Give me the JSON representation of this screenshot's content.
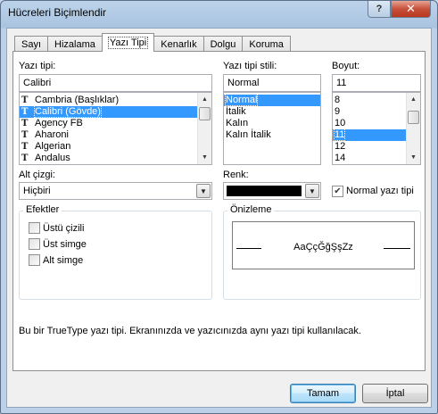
{
  "window": {
    "title": "Hücreleri Biçimlendir",
    "help_label": "?",
    "close_label": "✕"
  },
  "tabs": [
    {
      "label": "Sayı",
      "active": false
    },
    {
      "label": "Hizalama",
      "active": false
    },
    {
      "label": "Yazı Tipi",
      "active": true
    },
    {
      "label": "Kenarlık",
      "active": false
    },
    {
      "label": "Dolgu",
      "active": false
    },
    {
      "label": "Koruma",
      "active": false
    }
  ],
  "font": {
    "label": "Yazı tipi:",
    "value": "Calibri",
    "items": [
      {
        "label": "Cambria (Başlıklar)",
        "icon": "truetype-icon",
        "selected": false
      },
      {
        "label": "Calibri (Gövde)",
        "icon": "truetype-icon",
        "selected": true
      },
      {
        "label": "Agency FB",
        "icon": "truetype-icon",
        "selected": false
      },
      {
        "label": "Aharoni",
        "icon": "truetype-icon",
        "selected": false
      },
      {
        "label": "Algerian",
        "icon": "truetype-icon",
        "selected": false
      },
      {
        "label": "Andalus",
        "icon": "truetype-icon",
        "selected": false
      }
    ]
  },
  "style": {
    "label": "Yazı tipi stili:",
    "value": "Normal",
    "items": [
      {
        "label": "Normal",
        "selected": true
      },
      {
        "label": "İtalik",
        "selected": false
      },
      {
        "label": "Kalın",
        "selected": false
      },
      {
        "label": "Kalın İtalik",
        "selected": false
      }
    ]
  },
  "size": {
    "label": "Boyut:",
    "value": "11",
    "items": [
      {
        "label": "8",
        "selected": false
      },
      {
        "label": "9",
        "selected": false
      },
      {
        "label": "10",
        "selected": false
      },
      {
        "label": "11",
        "selected": true
      },
      {
        "label": "12",
        "selected": false
      },
      {
        "label": "14",
        "selected": false
      }
    ]
  },
  "underline": {
    "label": "Alt çizgi:",
    "value": "Hiçbiri"
  },
  "color": {
    "label": "Renk:",
    "value": "#000000",
    "normal_font_label": "Normal yazı tipi",
    "normal_font_checked": true
  },
  "effects": {
    "title": "Efektler",
    "items": [
      {
        "label": "Üstü çizili",
        "checked": false
      },
      {
        "label": "Üst simge",
        "checked": false
      },
      {
        "label": "Alt simge",
        "checked": false
      }
    ]
  },
  "preview": {
    "title": "Önizleme",
    "sample": "AaÇçĞğŞşZz"
  },
  "info_text": "Bu bir TrueType yazı tipi. Ekranınızda ve yazıcınızda aynı yazı tipi kullanılacak.",
  "buttons": {
    "ok": "Tamam",
    "cancel": "İptal"
  },
  "colors": {
    "selection": "#3399ff",
    "close_button": "#c7503a"
  }
}
